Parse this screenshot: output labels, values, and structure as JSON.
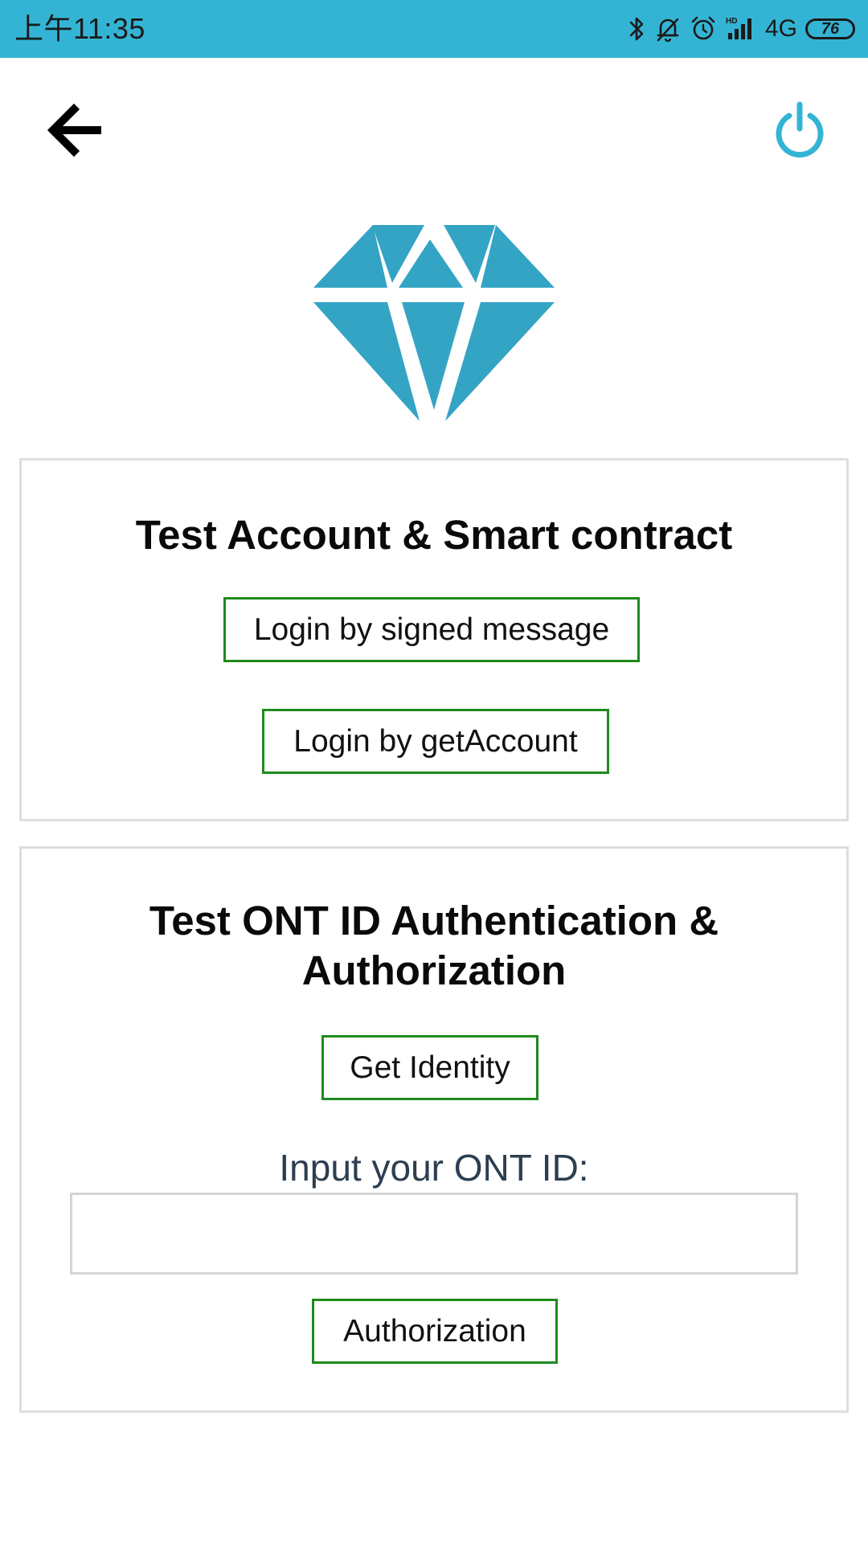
{
  "status_bar": {
    "time": "上午11:35",
    "network": "4G",
    "battery_level": "76",
    "icons": [
      "bluetooth-icon",
      "mute-bell-icon",
      "alarm-icon",
      "signal-icon",
      "network-icon",
      "battery-icon"
    ]
  },
  "header": {
    "back_icon": "arrow-left-icon",
    "power_icon": "power-icon"
  },
  "logo": {
    "icon": "diamond-icon",
    "color": "#34a4c4"
  },
  "colors": {
    "accent": "#34b4d4",
    "button_border": "#1e8a1e",
    "card_border": "#dedede"
  },
  "account_section": {
    "title": "Test Account & Smart contract",
    "buttons": {
      "signed_message": "Login by signed message",
      "get_account": "Login by getAccount"
    }
  },
  "ontid_section": {
    "title_line1": "Test ONT ID Authentication &",
    "title_line2": "Authorization",
    "get_identity": "Get Identity",
    "input_label": "Input your ONT ID:",
    "input_value": "",
    "authorization": "Authorization"
  }
}
